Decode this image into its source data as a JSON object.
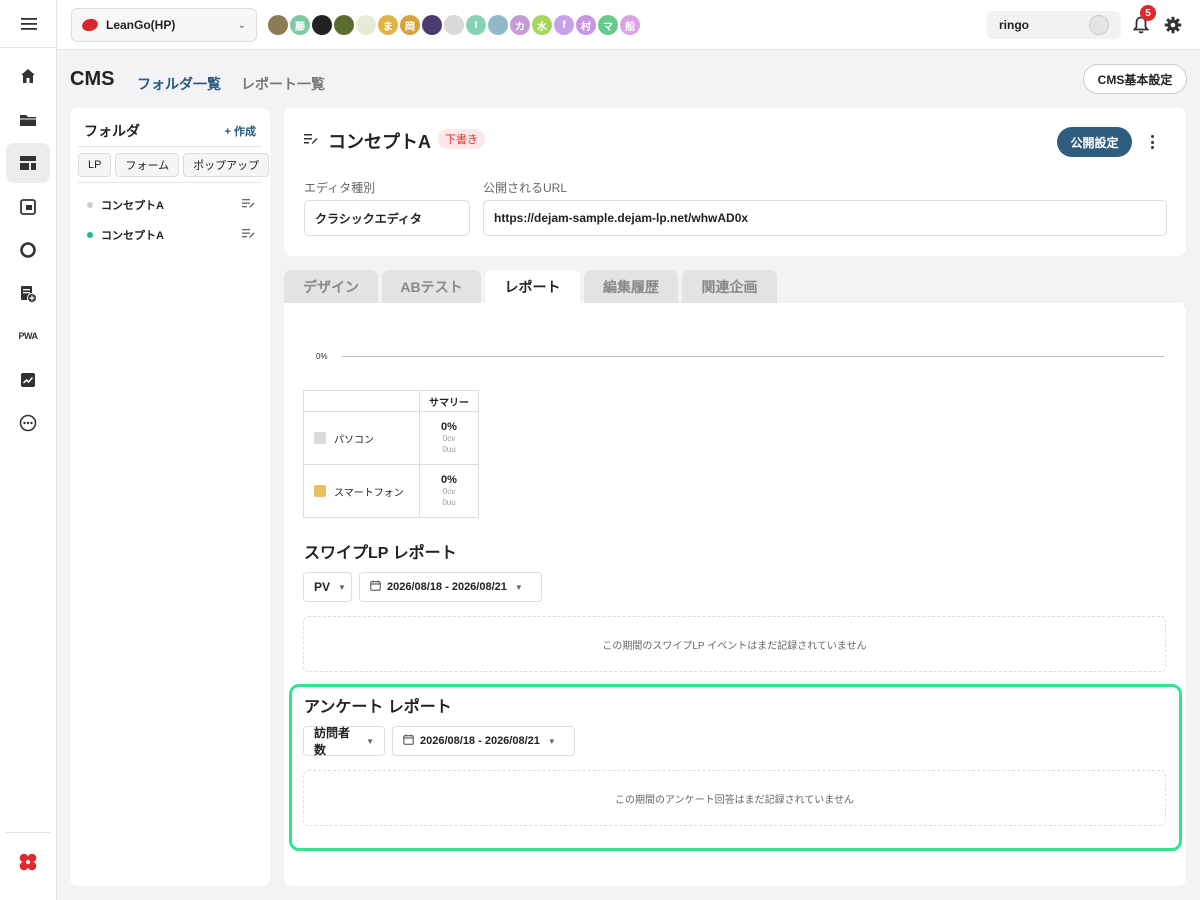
{
  "workspace": {
    "name": "LeanGo(HP)"
  },
  "members": [
    {
      "initial": "",
      "color": "#8c7b55"
    },
    {
      "initial": "藤",
      "color": "#7ec9a0"
    },
    {
      "initial": "",
      "color": "#222222"
    },
    {
      "initial": "",
      "color": "#5a6b2e"
    },
    {
      "initial": "",
      "color": "#e8ead8"
    },
    {
      "initial": "ま",
      "color": "#e3b343"
    },
    {
      "initial": "岡",
      "color": "#d6a33e"
    },
    {
      "initial": "",
      "color": "#4a3b6e"
    },
    {
      "initial": "",
      "color": "#d9d9d9"
    },
    {
      "initial": "I",
      "color": "#86d3b1"
    },
    {
      "initial": "",
      "color": "#8fb8c9"
    },
    {
      "initial": "カ",
      "color": "#c79ad8"
    },
    {
      "initial": "水",
      "color": "#a7d65a"
    },
    {
      "initial": "f",
      "color": "#c8a2e8"
    },
    {
      "initial": "村",
      "color": "#c896e2"
    },
    {
      "initial": "マ",
      "color": "#67c98c"
    },
    {
      "initial": "船",
      "color": "#d9a4e0"
    }
  ],
  "user": {
    "name": "ringo",
    "notifications": "5"
  },
  "page": {
    "title": "CMS",
    "tab_folders": "フォルダ一覧",
    "tab_reports": "レポート一覧",
    "settings_button": "CMS基本設定"
  },
  "folder": {
    "title": "フォルダ",
    "create": "+ 作成",
    "filters": [
      "LP",
      "フォーム",
      "ポップアップ"
    ],
    "items": [
      {
        "label": "コンセプトA",
        "dot": "#d0d0d0"
      },
      {
        "label": "コンセプトA",
        "dot": "#1fbf86"
      }
    ]
  },
  "lp": {
    "title": "コンセプトA",
    "status": "下書き",
    "publish_button": "公開設定",
    "editor_label": "エディタ種別",
    "editor_value": "クラシックエディタ",
    "url_label": "公開されるURL",
    "url_value": "https://dejam-sample.dejam-lp.net/whwAD0x"
  },
  "tabs": [
    "デザイン",
    "ABテスト",
    "レポート",
    "編集履歴",
    "関連企画"
  ],
  "chart_data": {
    "type": "line",
    "y_ticks": [
      "0%"
    ],
    "series": []
  },
  "summary": {
    "header": "サマリー",
    "rows": [
      {
        "device": "パソコン",
        "color": "#d9d9d9",
        "rate": "0%",
        "cv": "0cv",
        "uu": "0uu"
      },
      {
        "device": "スマートフォン",
        "color": "#e8c15e",
        "rate": "0%",
        "cv": "0cv",
        "uu": "0uu"
      }
    ]
  },
  "swipe": {
    "title": "スワイプLP レポート",
    "metric": "PV",
    "range": "2026/08/18 - 2026/08/21",
    "empty": "この期間のスワイプLP イベントはまだ記録されていません"
  },
  "survey": {
    "title": "アンケート レポート",
    "metric": "訪問者数",
    "range": "2026/08/18 - 2026/08/21",
    "empty": "この期間のアンケート回答はまだ記録されていません"
  },
  "highlight_color": "#2fe58d"
}
